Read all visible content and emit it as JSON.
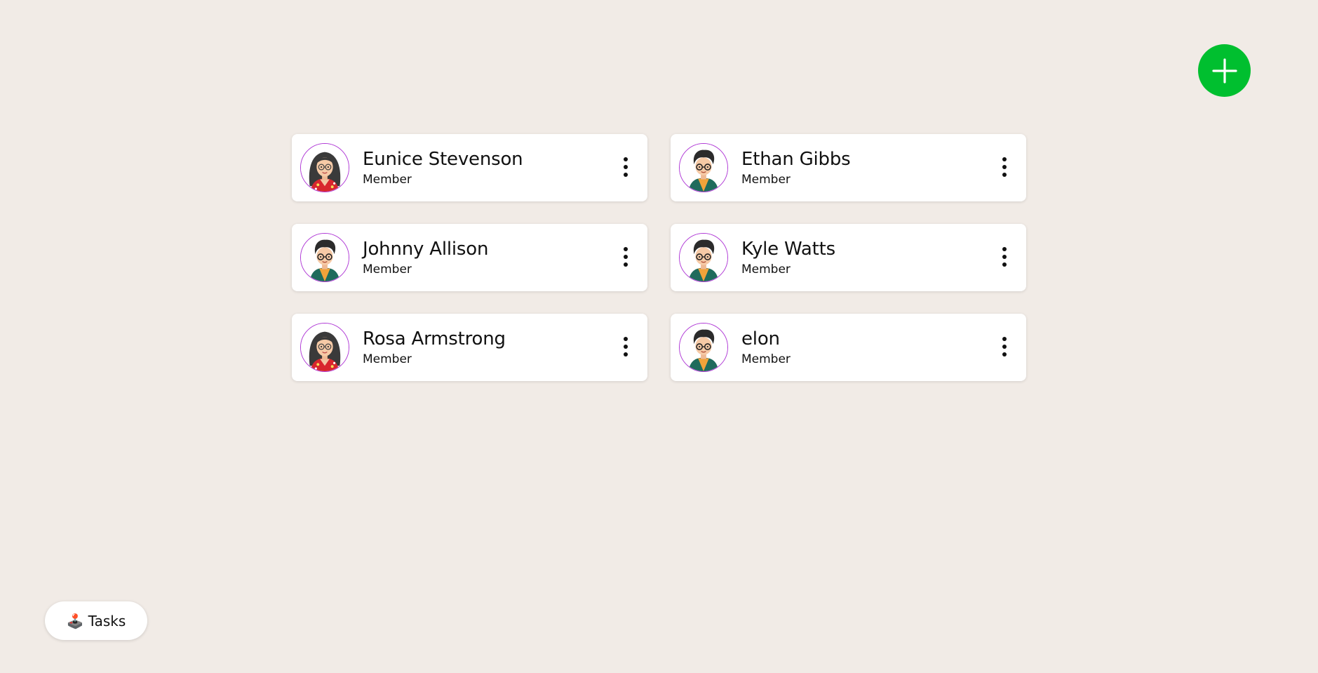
{
  "add_button": {
    "icon": "plus-icon",
    "color": "#00bf2f"
  },
  "members": [
    {
      "name": "Eunice Stevenson",
      "role": "Member",
      "avatar": "female"
    },
    {
      "name": "Ethan Gibbs",
      "role": "Member",
      "avatar": "male"
    },
    {
      "name": "Johnny Allison",
      "role": "Member",
      "avatar": "male"
    },
    {
      "name": "Kyle Watts",
      "role": "Member",
      "avatar": "male"
    },
    {
      "name": "Rosa Armstrong",
      "role": "Member",
      "avatar": "female"
    },
    {
      "name": "elon",
      "role": "Member",
      "avatar": "male"
    }
  ],
  "tasks_button": {
    "icon": "🕹️",
    "label": "Tasks"
  }
}
